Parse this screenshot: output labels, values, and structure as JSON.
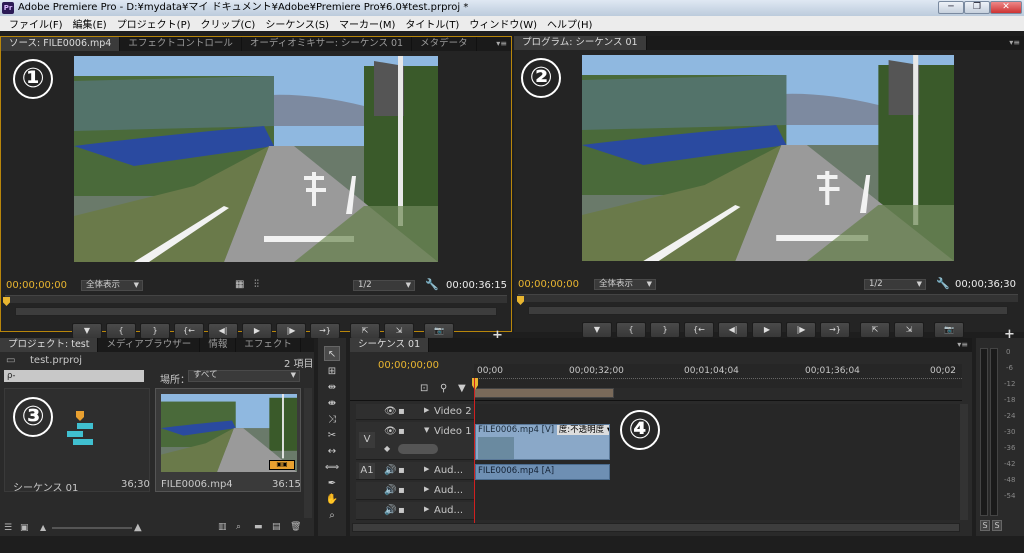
{
  "window": {
    "title": "Adobe Premiere Pro - D:¥mydata¥マイ ドキュメント¥Adobe¥Premiere Pro¥6.0¥test.prproj *",
    "app_icon": "Pr"
  },
  "window_controls": [
    "─",
    "❐",
    "✕"
  ],
  "menu": [
    "ファイル(F)",
    "編集(E)",
    "プロジェクト(P)",
    "クリップ(C)",
    "シーケンス(S)",
    "マーカー(M)",
    "タイトル(T)",
    "ウィンドウ(W)",
    "ヘルプ(H)"
  ],
  "source_panel": {
    "tabs": [
      "ソース: FILE0006.mp4",
      "エフェクトコントロール",
      "オーディオミキサー: シーケンス 01",
      "メタデータ"
    ],
    "label": "①",
    "timecode_in": "00;00;00;00",
    "zoom": "全体表示",
    "resolution": "1/2",
    "duration": "00:00:36:15"
  },
  "program_panel": {
    "tabs": [
      "プログラム: シーケンス 01"
    ],
    "label": "②",
    "timecode_in": "00;00;00;00",
    "zoom": "全体表示",
    "resolution": "1/2",
    "duration": "00;00;36;30"
  },
  "project_panel": {
    "tabs": [
      "プロジェクト: test",
      "メディアブラウザー",
      "情報",
      "エフェクト"
    ],
    "file": "test.prproj",
    "count": "2 項目",
    "search_placeholder": "ρ-",
    "location_label": "場所：",
    "location_value": "すべて",
    "label": "③",
    "items": [
      {
        "name": "シーケンス 01",
        "duration": "36;30"
      },
      {
        "name": "FILE0006.mp4",
        "duration": "36:15"
      }
    ]
  },
  "timeline": {
    "tab": "シーケンス 01",
    "timecode": "00;00;00;00",
    "ruler": [
      "00;00",
      "00;00;32;00",
      "00;01;04;04",
      "00;01;36;04",
      "00;02"
    ],
    "label": "④",
    "tracks": {
      "video2": "Video 2",
      "video1": "Video 1",
      "v_target": "V",
      "a_target": "A1",
      "audio": [
        "Aud...",
        "Aud...",
        "Aud..."
      ]
    },
    "video_clip": "FILE0006.mp4 [V]",
    "video_clip_effect": "度:不透明度 ▾",
    "audio_clip": "FILE0006.mp4 [A]"
  },
  "vu_meter": {
    "ticks": [
      "0",
      "-6",
      "-12",
      "-18",
      "-24",
      "-30",
      "-36",
      "-42",
      "-48",
      "-54"
    ],
    "buttons": [
      "S",
      "S"
    ]
  },
  "transport_icons": [
    "▼",
    "{",
    "}",
    "{←",
    "◀|",
    "▶",
    "|▶",
    "→}",
    "⇱",
    "⇲",
    "📷"
  ],
  "transport_icons_program": [
    "▼",
    "{",
    "}",
    "{←",
    "◀|",
    "▶",
    "|▶",
    "→}",
    "⇱",
    "⇲",
    "📷"
  ],
  "colors": {
    "accent_yellow": "#e8b530",
    "panel_border_active": "#b8860b",
    "clip_video": "#8aa8c8",
    "clip_audio": "#6e8fb3",
    "playhead": "#d02020"
  }
}
